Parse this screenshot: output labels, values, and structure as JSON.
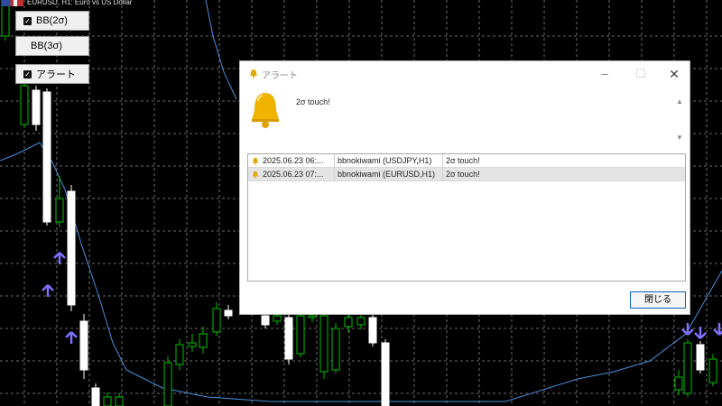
{
  "chart": {
    "symbol_title": "EURUSD, H1:  Euro vs US Dollar",
    "colors": {
      "background": "#000000",
      "bull": "#ffffff",
      "bear": "#00c000",
      "bb_line": "#4a8fdc",
      "arrow": "#8070ff",
      "grid": "#8a8a8a"
    }
  },
  "controls": {
    "bb2": {
      "label": "BB(2σ)",
      "checked": true
    },
    "bb3": {
      "label": "BB(3σ)",
      "checked": false
    },
    "alert": {
      "label": "アラート",
      "checked": true
    }
  },
  "dialog": {
    "title": "アラート",
    "message": "2σ touch!",
    "rows": [
      {
        "time": "2025.06.23 06:...",
        "indicator": "bbnokiwami (USDJPY,H1)",
        "message": "2σ touch!"
      },
      {
        "time": "2025.06.23 07:...",
        "indicator": "bbnokiwami (EURUSD,H1)",
        "message": "2σ touch!"
      }
    ],
    "close_label": "閉じる",
    "accent_color": "#0a64c8",
    "bell_color": "#f0b400"
  }
}
